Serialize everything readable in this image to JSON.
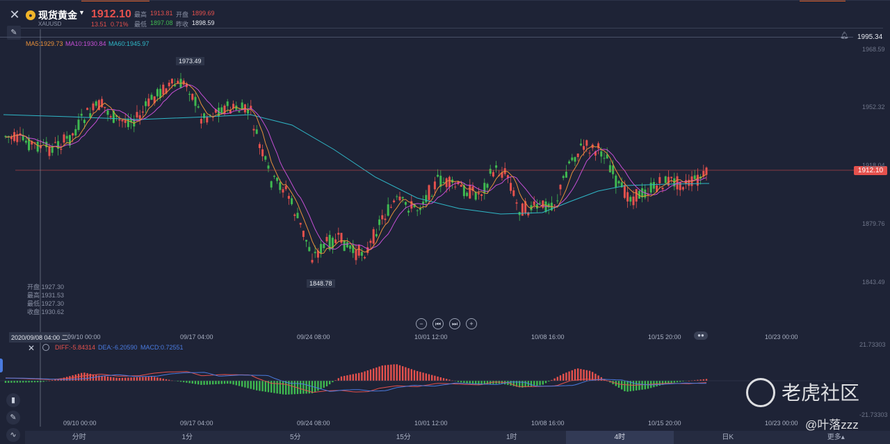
{
  "header": {
    "symbol_name": "现货黄金",
    "symbol_code": "XAUUSD",
    "price": "1912.10",
    "change": "13.51",
    "change_pct": "0.71%",
    "high_label": "最高",
    "high": "1913.81",
    "open_label": "开盘",
    "open": "1899.69",
    "low_label": "最低",
    "low": "1897.08",
    "prev_close_label": "昨收",
    "prev_close": "1898.59"
  },
  "main_chart": {
    "alert_price": "1995.34",
    "current_price_tag": "1912.10",
    "ma5": "MA5:1929.73",
    "ma10": "MA10:1930.84",
    "ma60": "MA60:1945.97",
    "y_ticks": [
      "1968.59",
      "1952.32",
      "1918.04",
      "1879.76",
      "1843.49"
    ],
    "peak_label": "1973.49",
    "trough_label": "1848.78",
    "cursor_date": "2020/09/08 04:00 二",
    "ohlc": [
      {
        "label": "开盘",
        "value": "1927.30"
      },
      {
        "label": "最高",
        "value": "1931.53"
      },
      {
        "label": "最低",
        "value": "1927.30"
      },
      {
        "label": "收盘",
        "value": "1930.62"
      }
    ],
    "x_dates": [
      "09/10 00:00",
      "09/17 04:00",
      "09/24 08:00",
      "10/01 12:00",
      "10/08 16:00",
      "10/15 20:00",
      "10/23 00:00"
    ]
  },
  "macd": {
    "diff": "DIFF:-5.84314",
    "dea": "DEA:-6.20590",
    "macd": "MACD:0.72551",
    "y_top": "21.73303",
    "y_bottom": "-21.73303"
  },
  "tabs": [
    {
      "label": "分时",
      "active": false
    },
    {
      "label": "1分",
      "active": false
    },
    {
      "label": "5分",
      "active": false
    },
    {
      "label": "15分",
      "active": false
    },
    {
      "label": "1时",
      "active": false
    },
    {
      "label": "4时",
      "active": true
    },
    {
      "label": "日K",
      "active": false
    },
    {
      "label": "更多▴",
      "active": false
    }
  ],
  "watermark": {
    "brand": "老虎社区",
    "user": "@叶落zzz"
  },
  "colors": {
    "up": "#e5514d",
    "down": "#3fb950",
    "ma5": "#e8903a",
    "ma10": "#c64fd6",
    "ma60": "#2fb8c8",
    "dea": "#4a7be0"
  }
}
